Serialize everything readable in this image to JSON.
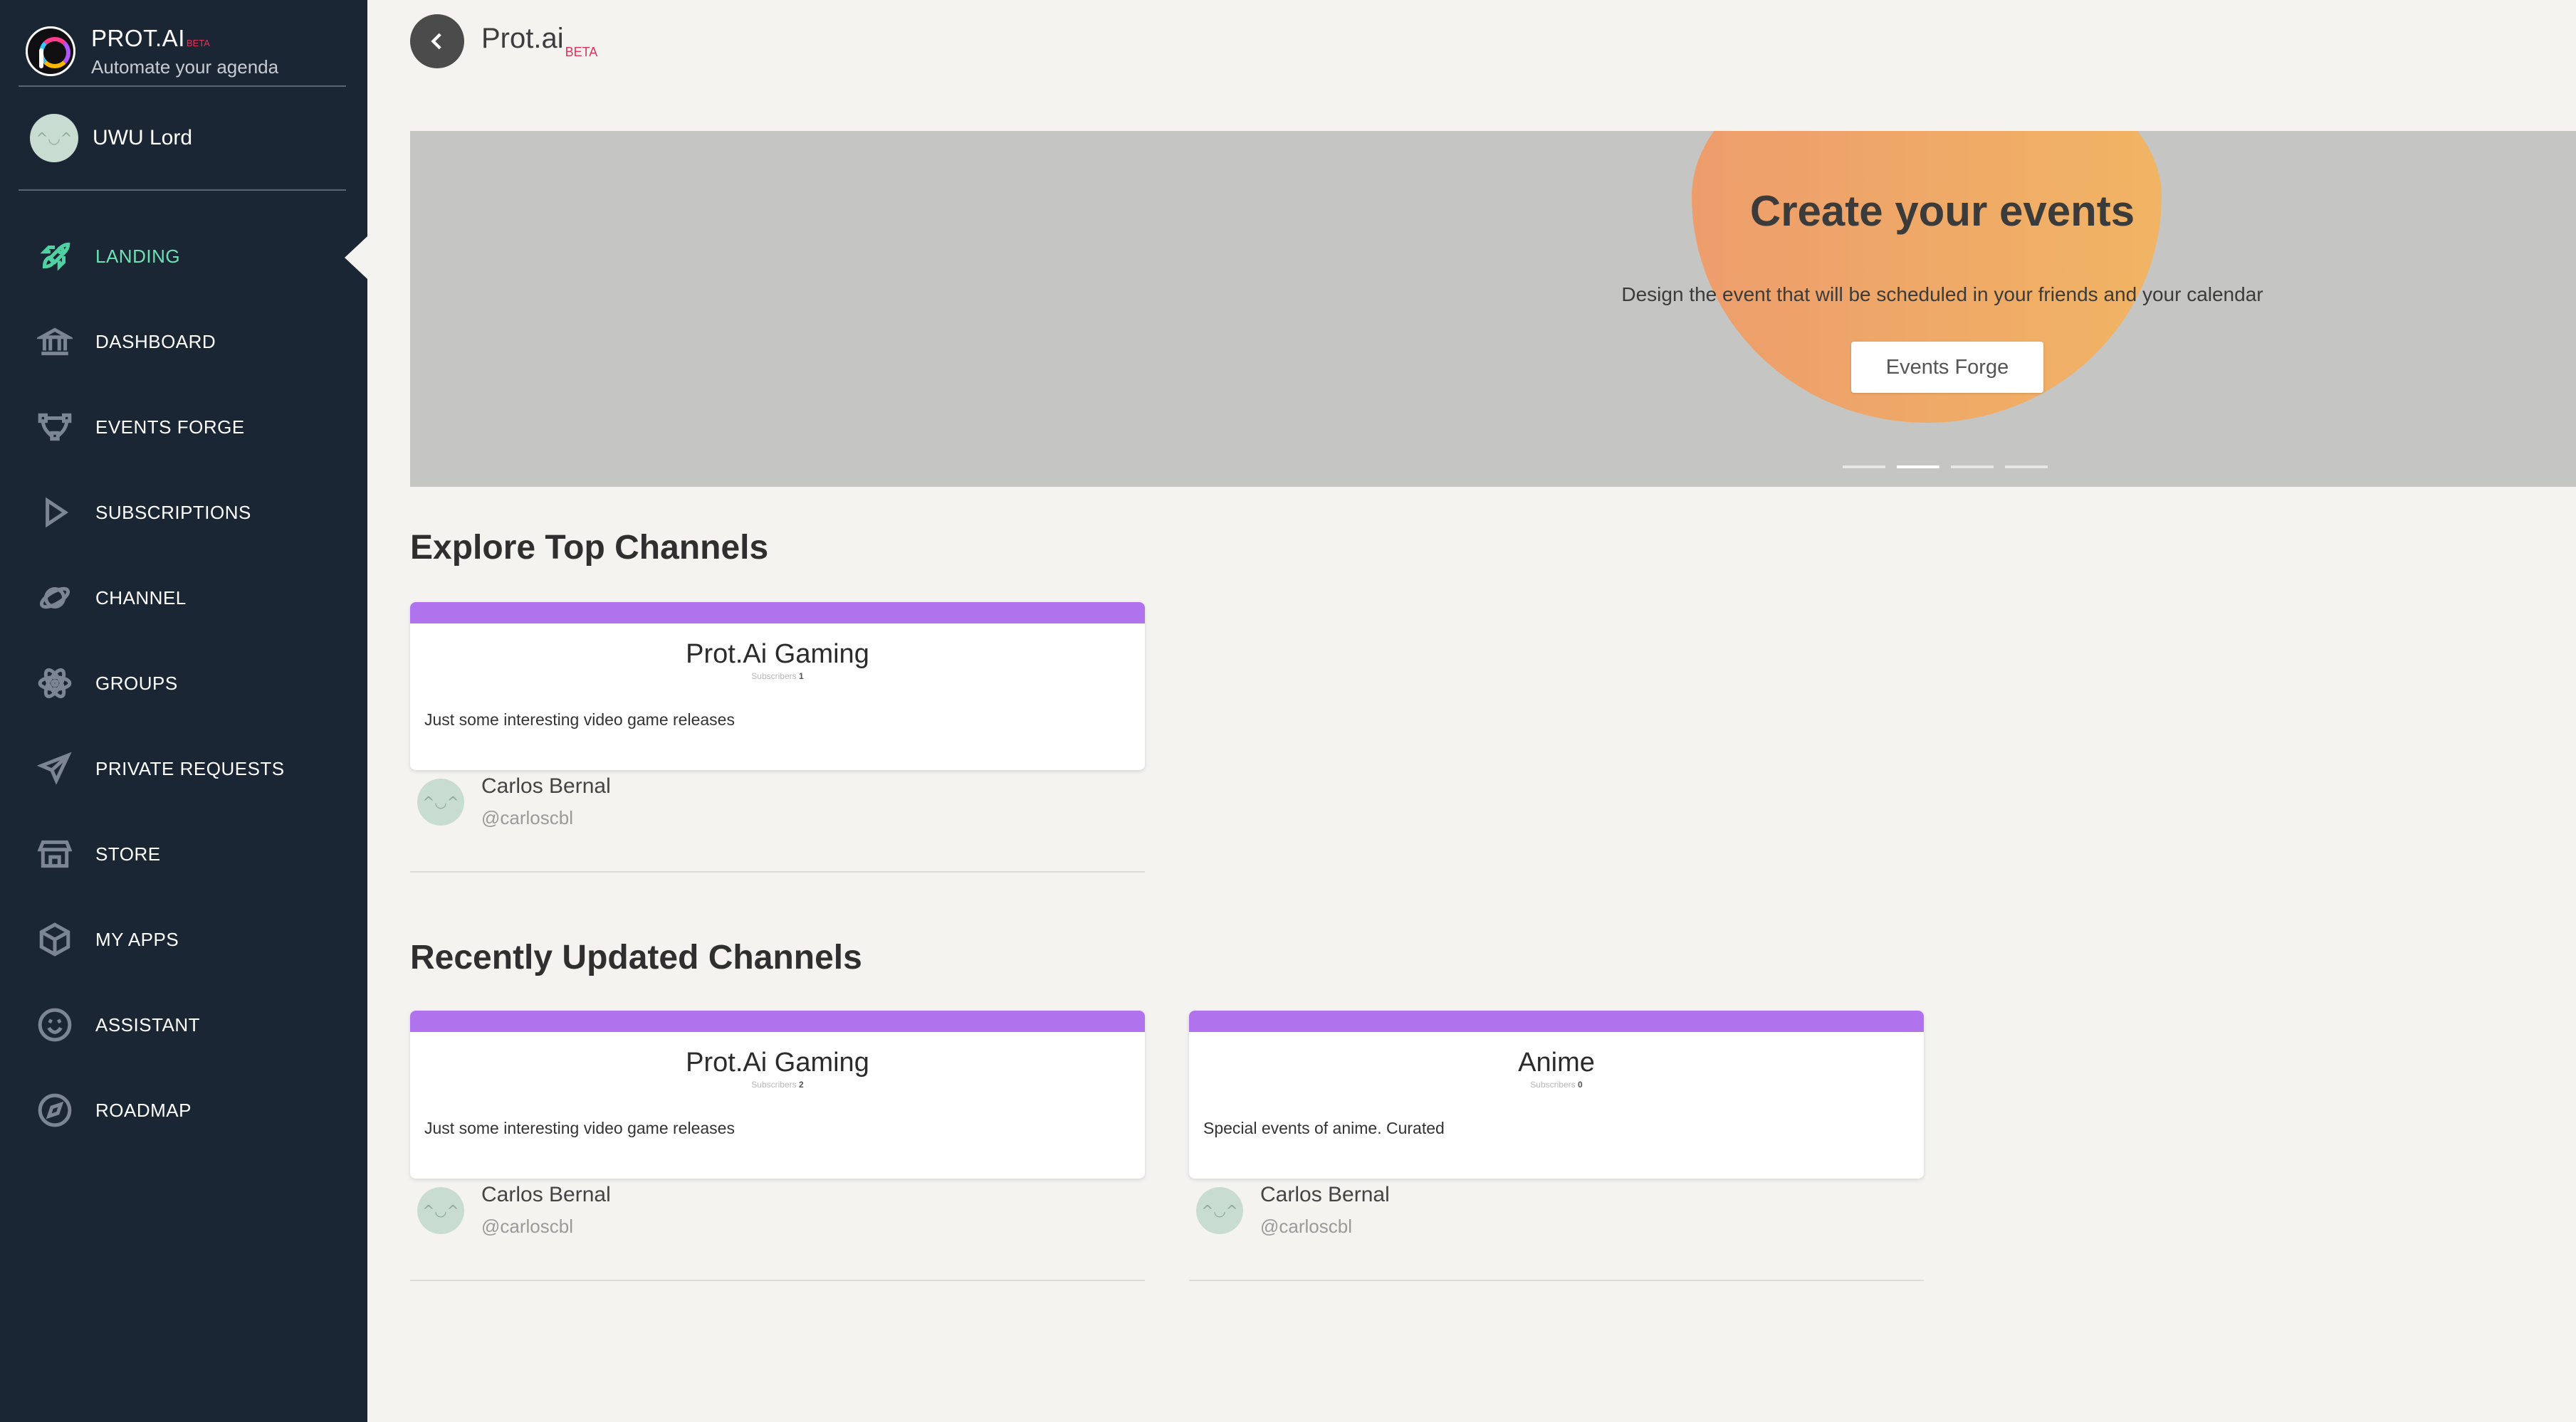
{
  "brand": {
    "name": "PROT.AI",
    "beta": "BETA",
    "tagline": "Automate your agenda"
  },
  "user": {
    "name": "UWU Lord"
  },
  "nav": [
    {
      "label": "LANDING",
      "icon": "rocket-icon",
      "active": true
    },
    {
      "label": "DASHBOARD",
      "icon": "bank-icon"
    },
    {
      "label": "EVENTS FORGE",
      "icon": "bezier-curve-icon"
    },
    {
      "label": "SUBSCRIPTIONS",
      "icon": "play-icon"
    },
    {
      "label": "CHANNEL",
      "icon": "planet-icon"
    },
    {
      "label": "GROUPS",
      "icon": "atom-icon"
    },
    {
      "label": "PRIVATE REQUESTS",
      "icon": "paper-plane-icon"
    },
    {
      "label": "STORE",
      "icon": "shop-icon"
    },
    {
      "label": "MY APPS",
      "icon": "box-icon"
    },
    {
      "label": "ASSISTANT",
      "icon": "smiley-icon"
    },
    {
      "label": "ROADMAP",
      "icon": "compass-icon"
    }
  ],
  "header": {
    "title": "Prot.ai",
    "beta": "BETA"
  },
  "banner": {
    "title": "Create your events",
    "subtitle": "Design the event that will be scheduled in your friends and your calendar",
    "button": "Events Forge",
    "active_slide": 2,
    "slides": 4
  },
  "sections": {
    "top": {
      "title": "Explore Top Channels",
      "cards": [
        {
          "title": "Prot.Ai Gaming",
          "subs_label": "Subscribers",
          "subs": "1",
          "desc": "Just some interesting video game releases",
          "owner": "Carlos Bernal",
          "handle": "@carloscbl"
        }
      ]
    },
    "recent": {
      "title": "Recently Updated Channels",
      "cards": [
        {
          "title": "Prot.Ai Gaming",
          "subs_label": "Subscribers",
          "subs": "2",
          "desc": "Just some interesting video game releases",
          "owner": "Carlos Bernal",
          "handle": "@carloscbl"
        },
        {
          "title": "Anime",
          "subs_label": "Subscribers",
          "subs": "0",
          "desc": "Special events of anime. Curated",
          "owner": "Carlos Bernal",
          "handle": "@carloscbl"
        }
      ]
    }
  },
  "colors": {
    "sidebar": "#1b2634",
    "accent": "#4fd1a1",
    "card_bar": "#b172ee",
    "beta": "#e0345b"
  }
}
